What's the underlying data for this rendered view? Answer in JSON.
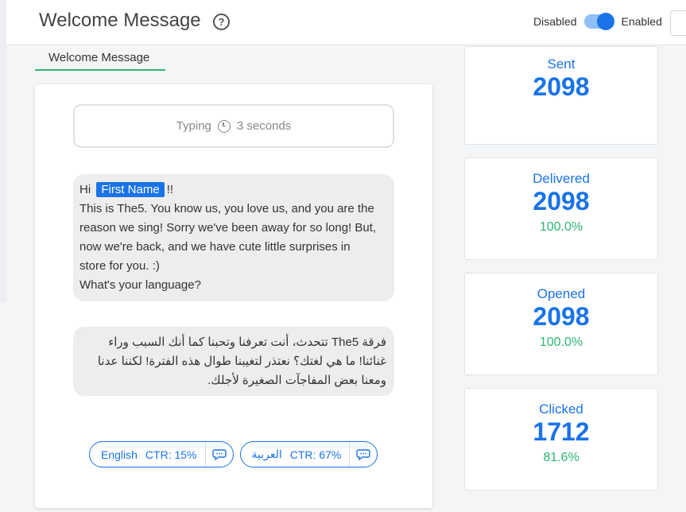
{
  "header": {
    "title": "Welcome Message",
    "help_icon": "question-circle-icon",
    "toggle_off_label": "Disabled",
    "toggle_on_label": "Enabled",
    "toggle_state": "enabled"
  },
  "tab": {
    "label": "Welcome Message"
  },
  "message": {
    "typing_label": "Typing",
    "typing_duration": "3 seconds",
    "greeting": "Hi",
    "name_placeholder": "First Name",
    "greeting_suffix": "!!",
    "body_line1": "This is The5. You know us, you love us, and you are the",
    "body_line2": "reason we sing! Sorry we've been away for so long! But,",
    "body_line3": "now we're back, and we have cute little surprises in",
    "body_line4": "store for you. :)",
    "body_line5": "What's your language?",
    "arabic_line1": "فرقة The5 تتحدث، أنت تعرفنا وتحبنا كما أنك السبب وراء",
    "arabic_line2": "غنائنا! ما هي لغتك؟ نعتذر لتغيبنا طوال هذه الفترة! لكننا عدنا",
    "arabic_line3": "ومعنا بعض المفاجآت الصغيرة لأجلك."
  },
  "quick_replies": [
    {
      "label": "English",
      "ctr": "CTR: 15%"
    },
    {
      "label": "العربية",
      "ctr": "CTR: 67%"
    }
  ],
  "stats": {
    "sent": {
      "label": "Sent",
      "value": "2098"
    },
    "delivered": {
      "label": "Delivered",
      "value": "2098",
      "pct": "100.0%"
    },
    "opened": {
      "label": "Opened",
      "value": "2098",
      "pct": "100.0%"
    },
    "clicked": {
      "label": "Clicked",
      "value": "1712",
      "pct": "81.6%"
    }
  },
  "colors": {
    "accent": "#1a73e8",
    "success": "#2bb673"
  }
}
